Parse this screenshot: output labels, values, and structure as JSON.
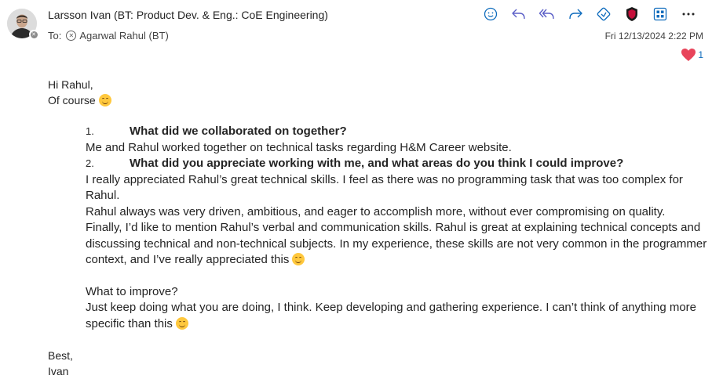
{
  "header": {
    "sender": "Larsson Ivan (BT: Product Dev. & Eng.: CoE Engineering)",
    "to_label": "To:",
    "recipient": "Agarwal Rahul (BT)",
    "date": "Fri 12/13/2024 2:22 PM"
  },
  "toolbar": {
    "icons": [
      "emoji-icon",
      "reply-icon",
      "reply-all-icon",
      "forward-icon",
      "loop-icon",
      "shield-icon",
      "apps-icon",
      "more-icon"
    ]
  },
  "reaction": {
    "icon": "heart-icon",
    "count": "1",
    "color": "#e8445a"
  },
  "message": {
    "greeting": "Hi Rahul,",
    "line2": "Of course",
    "q1_num": "1.",
    "q1": "What did we collaborated on together?",
    "a1": "Me and Rahul worked together on technical tasks regarding H&M Career website.",
    "q2_num": "2.",
    "q2": "What did you appreciate working with me, and what areas do you think I could improve?",
    "a2_1": "I really appreciated Rahul’s great technical skills. I feel as there was no programming task that was too complex for Rahul.",
    "a2_2": "Rahul always was very driven, ambitious, and eager to accomplish more, without ever compromising on quality.",
    "a2_3": "Finally, I’d like to mention Rahul’s verbal and communication skills. Rahul is great at explaining technical concepts and discussing technical and non-technical subjects. In my experience, these skills are not very common in the programmer context, and I’ve really appreciated this",
    "improve_title": "What to improve?",
    "improve_body": "Just keep doing what you are doing, I think. Keep developing and gathering experience. I can’t think of anything more specific than this",
    "signoff": "Best,",
    "name": "Ivan"
  },
  "colors": {
    "accent": "#0f6cbd",
    "shield": "#a4262c"
  }
}
